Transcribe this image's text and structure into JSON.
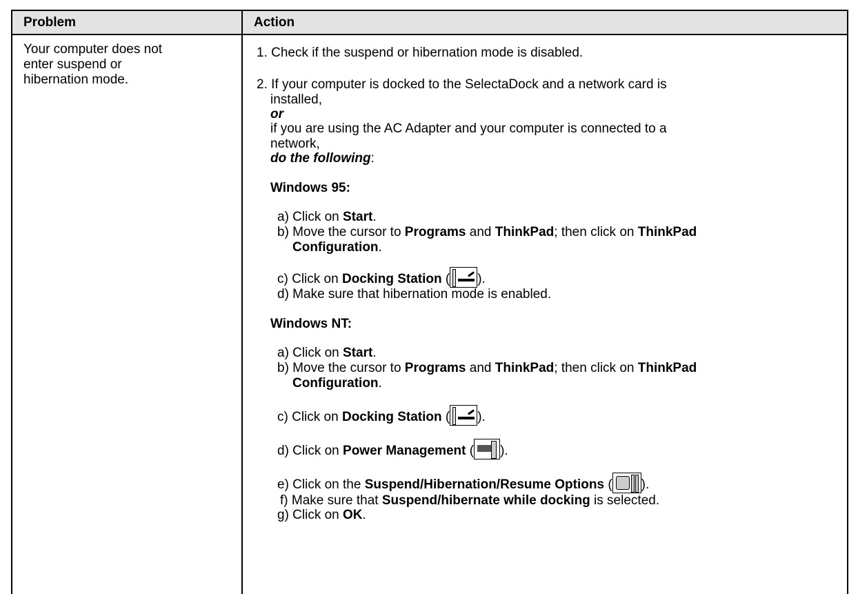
{
  "table": {
    "header_problem": "Problem",
    "header_action": "Action",
    "problem": [
      "Your computer does not",
      "enter suspend or",
      "hibernation mode."
    ]
  },
  "action": {
    "step1": "1. Check if the suspend or hibernation mode is disabled.",
    "step2_line1": "2. If your computer is docked to the SelectaDock and a network card is",
    "step2_line2": "installed,",
    "or": "or",
    "step2_line3": "if you are using the AC Adapter and your computer is connected to a",
    "step2_line4": "network,",
    "do_following": "do the following",
    "colon": ":",
    "win95": {
      "heading": "Windows 95:",
      "a_pre": "a) Click on ",
      "a_bold": "Start",
      "a_post": ".",
      "b_pre": "b) Move the cursor to ",
      "b_bold1": "Programs",
      "b_mid1": " and ",
      "b_bold2": "ThinkPad",
      "b_mid2": "; then click on ",
      "b_bold3": "ThinkPad",
      "b2_bold": "Configuration",
      "b2_post": ".",
      "c_pre": "c) Click on ",
      "c_bold": "Docking Station",
      "c_open": " (",
      "c_close": ").",
      "d": "d) Make sure that hibernation mode is enabled."
    },
    "winnt": {
      "heading": "Windows NT:",
      "a_pre": "a) Click on ",
      "a_bold": "Start",
      "a_post": ".",
      "b_pre": "b) Move the cursor to ",
      "b_bold1": "Programs",
      "b_mid1": " and ",
      "b_bold2": "ThinkPad",
      "b_mid2": "; then click on ",
      "b_bold3": "ThinkPad",
      "b2_bold": "Configuration",
      "b2_post": ".",
      "c_pre": "c) Click on ",
      "c_bold": "Docking Station",
      "c_open": " (",
      "c_close": ").",
      "d_pre": "d) Click on ",
      "d_bold": "Power Management",
      "d_open": " (",
      "d_close": ").",
      "e_pre": "e) Click on the ",
      "e_bold": "Suspend/Hibernation/Resume Options",
      "e_open": " (",
      "e_close": ").",
      "f_pre": "f) Make sure that ",
      "f_bold": "Suspend/hibernate while docking",
      "f_post": " is selected.",
      "g_pre": "g) Click on ",
      "g_bold": "OK",
      "g_post": "."
    },
    "icons": {
      "docking_station": "docking-station-icon",
      "power_management": "power-management-icon",
      "suspend_options": "suspend-hibernation-options-icon"
    }
  }
}
